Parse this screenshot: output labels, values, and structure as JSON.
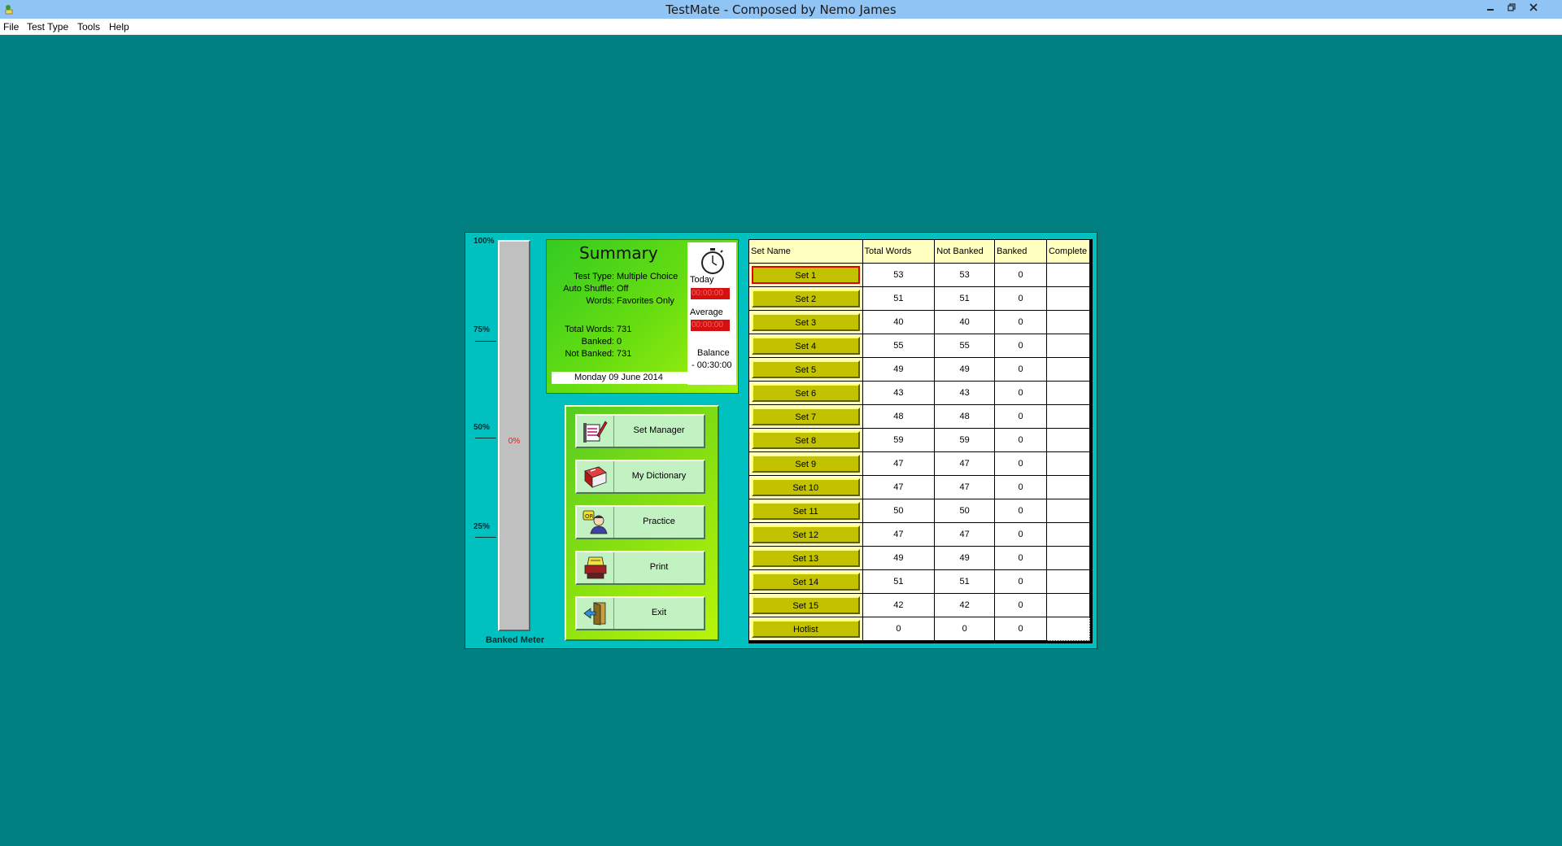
{
  "window": {
    "title": "TestMate - Composed by Nemo James",
    "icon": "testmate-app-icon"
  },
  "menu": [
    {
      "label": "File"
    },
    {
      "label": "Test Type"
    },
    {
      "label": "Tools"
    },
    {
      "label": "Help"
    }
  ],
  "meter": {
    "caption": "Banked Meter",
    "percent_text": "0%",
    "banked_fraction": 0,
    "ticks": [
      "100%",
      "75%",
      "50%",
      "25%"
    ]
  },
  "summary": {
    "title": "Summary",
    "rows_top": [
      {
        "label": "Test Type:",
        "value": "Multiple Choice"
      },
      {
        "label": "Auto Shuffle:",
        "value": "Off"
      },
      {
        "label": "Words:",
        "value": "Favorites Only"
      }
    ],
    "rows_bottom": [
      {
        "label": "Total Words:",
        "value": "731"
      },
      {
        "label": "Banked:",
        "value": "0"
      },
      {
        "label": "Not Banked:",
        "value": "731"
      }
    ],
    "date": "Monday 09 June 2014",
    "timer": {
      "today_label": "Today",
      "today_value": "00:00:00",
      "average_label": "Average",
      "average_value": "00:00:00",
      "balance_label": "Balance",
      "balance_value": "- 00:30:00"
    }
  },
  "nav_buttons": [
    {
      "label": "Set Manager",
      "icon": "set-manager-icon"
    },
    {
      "label": "My Dictionary",
      "icon": "dictionary-book-icon"
    },
    {
      "label": "Practice",
      "icon": "practice-person-icon"
    },
    {
      "label": "Print",
      "icon": "printer-icon"
    },
    {
      "label": "Exit",
      "icon": "exit-door-icon"
    }
  ],
  "table": {
    "headers": [
      "Set Name",
      "Total Words",
      "Not Banked",
      "Banked",
      "Complete"
    ],
    "rows": [
      {
        "name": "Set 1",
        "total": "53",
        "not_banked": "53",
        "banked": "0",
        "complete": ""
      },
      {
        "name": "Set 2",
        "total": "51",
        "not_banked": "51",
        "banked": "0",
        "complete": ""
      },
      {
        "name": "Set 3",
        "total": "40",
        "not_banked": "40",
        "banked": "0",
        "complete": ""
      },
      {
        "name": "Set 4",
        "total": "55",
        "not_banked": "55",
        "banked": "0",
        "complete": ""
      },
      {
        "name": "Set 5",
        "total": "49",
        "not_banked": "49",
        "banked": "0",
        "complete": ""
      },
      {
        "name": "Set 6",
        "total": "43",
        "not_banked": "43",
        "banked": "0",
        "complete": ""
      },
      {
        "name": "Set 7",
        "total": "48",
        "not_banked": "48",
        "banked": "0",
        "complete": ""
      },
      {
        "name": "Set 8",
        "total": "59",
        "not_banked": "59",
        "banked": "0",
        "complete": ""
      },
      {
        "name": "Set 9",
        "total": "47",
        "not_banked": "47",
        "banked": "0",
        "complete": ""
      },
      {
        "name": "Set 10",
        "total": "47",
        "not_banked": "47",
        "banked": "0",
        "complete": ""
      },
      {
        "name": "Set 11",
        "total": "50",
        "not_banked": "50",
        "banked": "0",
        "complete": ""
      },
      {
        "name": "Set 12",
        "total": "47",
        "not_banked": "47",
        "banked": "0",
        "complete": ""
      },
      {
        "name": "Set 13",
        "total": "49",
        "not_banked": "49",
        "banked": "0",
        "complete": ""
      },
      {
        "name": "Set 14",
        "total": "51",
        "not_banked": "51",
        "banked": "0",
        "complete": ""
      },
      {
        "name": "Set 15",
        "total": "42",
        "not_banked": "42",
        "banked": "0",
        "complete": ""
      },
      {
        "name": "Hotlist",
        "total": "0",
        "not_banked": "0",
        "banked": "0",
        "complete": ""
      }
    ],
    "selected_row": 0
  },
  "colors": {
    "desktop": "#008080",
    "panel": "#00c0c0",
    "set_button": "#c2c200",
    "header_bg": "#ffffc0",
    "timer_red": "#d51010"
  }
}
